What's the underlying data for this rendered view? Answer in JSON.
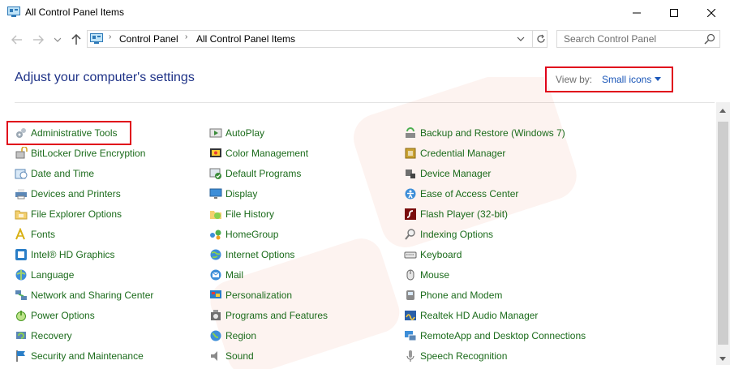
{
  "window": {
    "title": "All Control Panel Items",
    "minimize_icon": "minimize-icon",
    "maximize_icon": "maximize-icon",
    "close_icon": "close-icon"
  },
  "address_bar": {
    "crumbs": [
      "Control Panel",
      "All Control Panel Items"
    ],
    "separator": "›"
  },
  "search": {
    "placeholder": "Search Control Panel"
  },
  "header": {
    "heading": "Adjust your computer's settings",
    "view_by_label": "View by:",
    "view_by_value": "Small icons"
  },
  "items": {
    "col1": [
      {
        "label": "Administrative Tools",
        "icon": "admin-tools-icon"
      },
      {
        "label": "BitLocker Drive Encryption",
        "icon": "bitlocker-icon"
      },
      {
        "label": "Date and Time",
        "icon": "clock-icon"
      },
      {
        "label": "Devices and Printers",
        "icon": "printer-icon"
      },
      {
        "label": "File Explorer Options",
        "icon": "folder-options-icon"
      },
      {
        "label": "Fonts",
        "icon": "fonts-icon"
      },
      {
        "label": "Intel® HD Graphics",
        "icon": "intel-graphics-icon"
      },
      {
        "label": "Language",
        "icon": "language-icon"
      },
      {
        "label": "Network and Sharing Center",
        "icon": "network-icon"
      },
      {
        "label": "Power Options",
        "icon": "power-icon"
      },
      {
        "label": "Recovery",
        "icon": "recovery-icon"
      },
      {
        "label": "Security and Maintenance",
        "icon": "flag-icon"
      }
    ],
    "col2": [
      {
        "label": "AutoPlay",
        "icon": "autoplay-icon"
      },
      {
        "label": "Color Management",
        "icon": "color-management-icon"
      },
      {
        "label": "Default Programs",
        "icon": "default-programs-icon"
      },
      {
        "label": "Display",
        "icon": "display-icon"
      },
      {
        "label": "File History",
        "icon": "file-history-icon"
      },
      {
        "label": "HomeGroup",
        "icon": "homegroup-icon"
      },
      {
        "label": "Internet Options",
        "icon": "globe-icon"
      },
      {
        "label": "Mail",
        "icon": "mail-icon"
      },
      {
        "label": "Personalization",
        "icon": "personalization-icon"
      },
      {
        "label": "Programs and Features",
        "icon": "programs-icon"
      },
      {
        "label": "Region",
        "icon": "region-icon"
      },
      {
        "label": "Sound",
        "icon": "speaker-icon"
      }
    ],
    "col3": [
      {
        "label": "Backup and Restore (Windows 7)",
        "icon": "backup-icon"
      },
      {
        "label": "Credential Manager",
        "icon": "credential-icon"
      },
      {
        "label": "Device Manager",
        "icon": "device-manager-icon"
      },
      {
        "label": "Ease of Access Center",
        "icon": "ease-of-access-icon"
      },
      {
        "label": "Flash Player (32-bit)",
        "icon": "flash-icon"
      },
      {
        "label": "Indexing Options",
        "icon": "indexing-icon"
      },
      {
        "label": "Keyboard",
        "icon": "keyboard-icon"
      },
      {
        "label": "Mouse",
        "icon": "mouse-icon"
      },
      {
        "label": "Phone and Modem",
        "icon": "phone-icon"
      },
      {
        "label": "Realtek HD Audio Manager",
        "icon": "audio-manager-icon"
      },
      {
        "label": "RemoteApp and Desktop Connections",
        "icon": "remoteapp-icon"
      },
      {
        "label": "Speech Recognition",
        "icon": "microphone-icon"
      }
    ]
  },
  "colors": {
    "item_text": "#1b6b1b",
    "heading": "#1e3287",
    "link_blue": "#1a56b8",
    "highlight": "#e0001a"
  }
}
